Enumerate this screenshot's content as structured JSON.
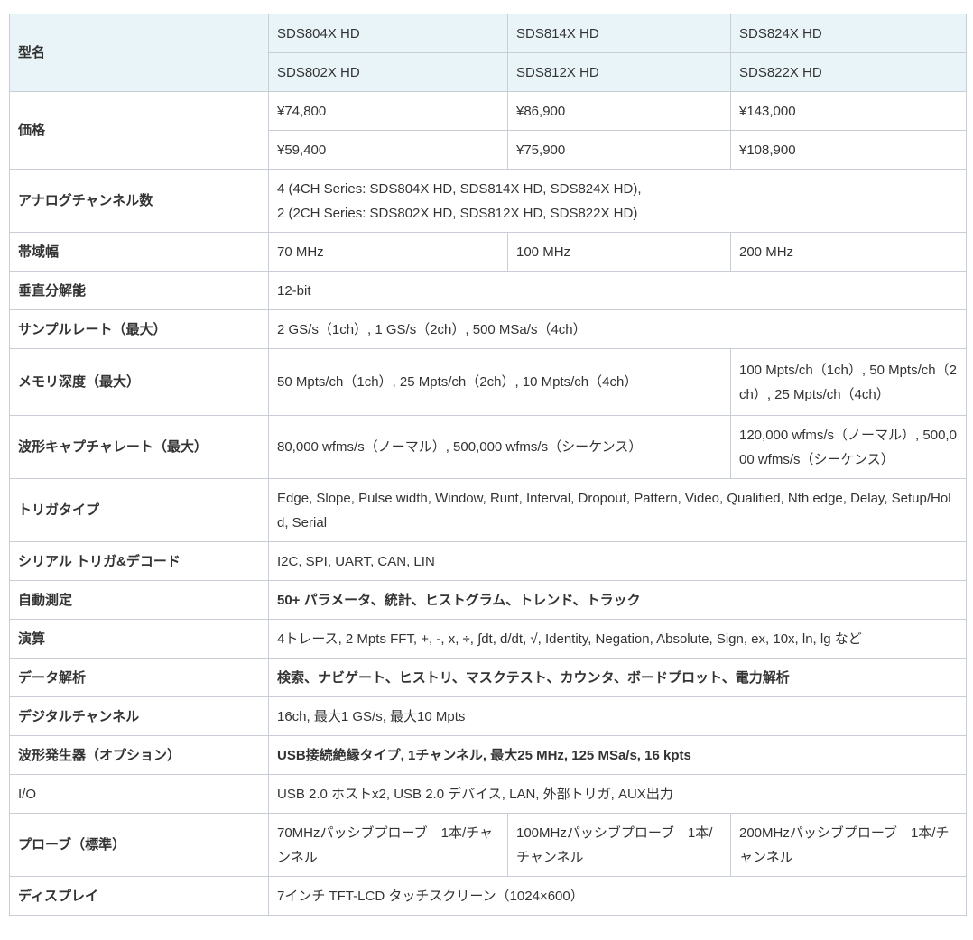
{
  "rows": {
    "model": {
      "label": "型名",
      "r1": [
        "SDS804X HD",
        "SDS814X HD",
        "SDS824X HD"
      ],
      "r2": [
        "SDS802X HD",
        "SDS812X HD",
        "SDS822X HD"
      ]
    },
    "price": {
      "label": "価格",
      "r1": [
        "¥74,800",
        "¥86,900",
        "¥143,000"
      ],
      "r2": [
        "¥59,400",
        "¥75,900",
        "¥108,900"
      ]
    },
    "analog": {
      "label": "アナログチャンネル数",
      "l1": "4 (4CH Series: SDS804X HD, SDS814X HD, SDS824X HD),",
      "l2": "2 (2CH Series: SDS802X HD, SDS812X HD, SDS822X HD)"
    },
    "bandwidth": {
      "label": "帯域幅",
      "values": [
        "70 MHz",
        "100 MHz",
        "200 MHz"
      ]
    },
    "vres": {
      "label": "垂直分解能",
      "value": "12-bit"
    },
    "sample": {
      "label": "サンプルレート（最大）",
      "value": "2 GS/s（1ch）, 1 GS/s（2ch）, 500 MSa/s（4ch）"
    },
    "memory": {
      "label": "メモリ深度（最大）",
      "values": [
        "50 Mpts/ch（1ch）, 25 Mpts/ch（2ch）, 10 Mpts/ch（4ch）",
        "100 Mpts/ch（1ch）, 50 Mpts/ch（2ch）, 25 Mpts/ch（4ch）"
      ]
    },
    "capture": {
      "label": "波形キャプチャレート（最大）",
      "values": [
        "80,000 wfms/s（ノーマル）, 500,000 wfms/s（シーケンス）",
        "120,000 wfms/s（ノーマル）, 500,000 wfms/s（シーケンス）"
      ]
    },
    "trigger": {
      "label": "トリガタイプ",
      "value": "Edge, Slope, Pulse width, Window, Runt, Interval, Dropout, Pattern, Video, Qualified, Nth edge, Delay, Setup/Hold, Serial"
    },
    "serial": {
      "label": "シリアル トリガ&デコード",
      "value": "I2C, SPI, UART, CAN, LIN"
    },
    "measure": {
      "label": "自動測定",
      "value": "50+ パラメータ、統計、ヒストグラム、トレンド、トラック"
    },
    "math": {
      "label": "演算",
      "value": "4トレース, 2 Mpts FFT, +, -, x, ÷, ∫dt, d/dt, √, Identity, Negation, Absolute, Sign, ex, 10x, ln, lg など"
    },
    "analysis": {
      "label": "データ解析",
      "value": "検索、ナビゲート、ヒストリ、マスクテスト、カウンタ、ボードプロット、電力解析"
    },
    "digital": {
      "label": "デジタルチャンネル",
      "value": "16ch, 最大1 GS/s, 最大10 Mpts"
    },
    "awg": {
      "label": "波形発生器（オプション）",
      "value": "USB接続絶縁タイプ, 1チャンネル, 最大25 MHz, 125 MSa/s, 16 kpts"
    },
    "io": {
      "label": "I/O",
      "value": "USB 2.0 ホストx2, USB 2.0 デバイス, LAN, 外部トリガ, AUX出力"
    },
    "probe": {
      "label": "プローブ（標準）",
      "values": [
        "70MHzパッシブプローブ　1本/チャンネル",
        "100MHzパッシブプローブ　1本/チャンネル",
        "200MHzパッシブプローブ　1本/チャンネル"
      ]
    },
    "display": {
      "label": "ディスプレイ",
      "value": "7インチ TFT-LCD タッチスクリーン（1024×600）"
    }
  }
}
